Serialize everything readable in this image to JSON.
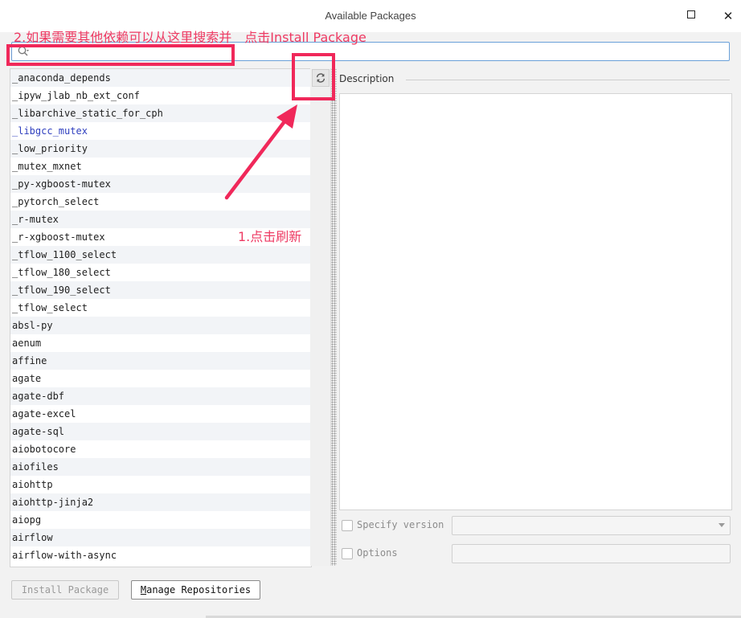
{
  "window": {
    "title": "Available Packages"
  },
  "search": {
    "value": "",
    "placeholder": ""
  },
  "packages": [
    "_anaconda_depends",
    "_ipyw_jlab_nb_ext_conf",
    "_libarchive_static_for_cph",
    "_libgcc_mutex",
    "_low_priority",
    "_mutex_mxnet",
    "_py-xgboost-mutex",
    "_pytorch_select",
    "_r-mutex",
    "_r-xgboost-mutex",
    "_tflow_1100_select",
    "_tflow_180_select",
    "_tflow_190_select",
    "_tflow_select",
    "absl-py",
    "aenum",
    "affine",
    "agate",
    "agate-dbf",
    "agate-excel",
    "agate-sql",
    "aiobotocore",
    "aiofiles",
    "aiohttp",
    "aiohttp-jinja2",
    "aiopg",
    "airflow",
    "airflow-with-async"
  ],
  "description": {
    "label": "Description",
    "text": ""
  },
  "options": {
    "specify_version_label": "Specify version",
    "specify_version_value": "",
    "options_label": "Options",
    "options_value": ""
  },
  "buttons": {
    "install": "Install Package",
    "manage_first": "M",
    "manage_rest": "anage Repositories"
  },
  "annotations": {
    "step2": "2.如果需要其他依赖可以从这里搜索并　点击Install Package",
    "step1": "1.点击刷新",
    "color": "#f0285a"
  },
  "icons": {
    "search": "search-icon",
    "refresh": "refresh-icon",
    "close": "close-icon",
    "maximize": "maximize-icon"
  }
}
